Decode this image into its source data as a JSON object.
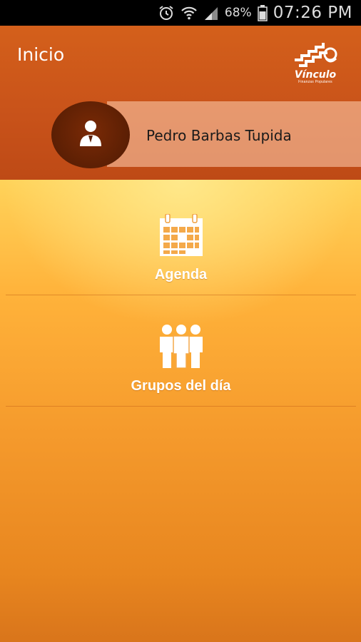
{
  "status_bar": {
    "battery_percent": "68%",
    "time": "07:26 PM",
    "icons": [
      "alarm-icon",
      "wifi-icon",
      "signal-icon",
      "battery-icon"
    ]
  },
  "header": {
    "title": "Inicio",
    "logo": {
      "name": "Vínculo",
      "tagline": "Finanzas Populares"
    }
  },
  "user": {
    "name": "Pedro Barbas Tupida",
    "avatar_icon": "user-icon"
  },
  "menu": [
    {
      "label": "Agenda",
      "icon": "calendar-icon"
    },
    {
      "label": "Grupos del día",
      "icon": "group-icon"
    }
  ],
  "colors": {
    "header": "#c9531a",
    "avatar": "#5c1f04",
    "content_top": "#ffd35a",
    "content_bottom": "#d9751b"
  }
}
